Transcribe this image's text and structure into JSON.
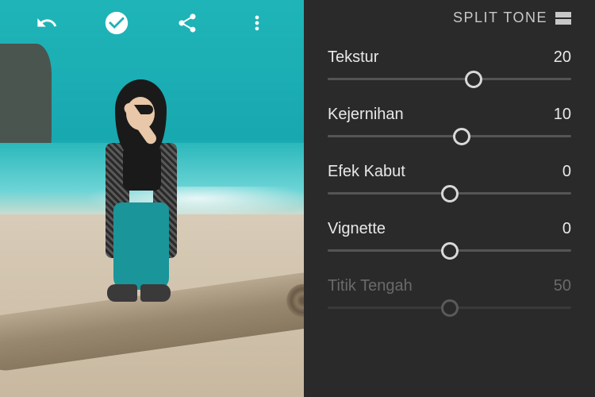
{
  "toolbar": {
    "icons": [
      "undo-icon",
      "confirm-icon",
      "share-icon",
      "menu-icon"
    ]
  },
  "tab": {
    "label": "SPLIT TONE"
  },
  "sliders": [
    {
      "label": "Tekstur",
      "value": "20",
      "position": 60,
      "disabled": false
    },
    {
      "label": "Kejernihan",
      "value": "10",
      "position": 55,
      "disabled": false
    },
    {
      "label": "Efek Kabut",
      "value": "0",
      "position": 50,
      "disabled": false
    },
    {
      "label": "Vignette",
      "value": "0",
      "position": 50,
      "disabled": false
    },
    {
      "label": "Titik Tengah",
      "value": "50",
      "position": 50,
      "disabled": true
    }
  ]
}
